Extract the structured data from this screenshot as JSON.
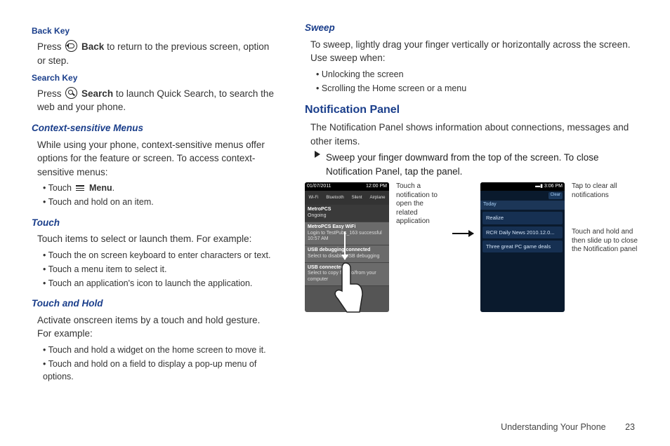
{
  "left": {
    "back_key": {
      "heading": "Back Key",
      "text_pre": "Press ",
      "icon_label": "Back",
      "text_post": " to return to the previous screen, option or step."
    },
    "search_key": {
      "heading": "Search Key",
      "text_pre": "Press ",
      "icon_label": "Search",
      "text_post": " to launch Quick Search, to search the web and your phone."
    },
    "context_menus": {
      "heading": "Context-sensitive Menus",
      "body": "While using your phone, context-sensitive menus offer options for the feature or screen. To access context-sensitive menus:",
      "bullet1_pre": "Touch ",
      "bullet1_label": "Menu",
      "bullet1_post": ".",
      "bullet2": "Touch and hold on an item."
    },
    "touch": {
      "heading": "Touch",
      "body": "Touch items to select or launch them. For example:",
      "bullets": [
        "Touch the on screen keyboard to enter characters or text.",
        "Touch a menu item to select it.",
        "Touch an application's icon to launch the application."
      ]
    },
    "touch_hold": {
      "heading": "Touch and Hold",
      "body": "Activate onscreen items by a touch and hold gesture. For example:",
      "bullets": [
        "Touch and hold a widget on the home screen to move it.",
        "Touch and hold on a field to display a pop-up menu of options."
      ]
    }
  },
  "right": {
    "sweep": {
      "heading": "Sweep",
      "body": "To sweep, lightly drag your finger vertically or horizontally across the screen. Use sweep when:",
      "bullets": [
        "Unlocking the screen",
        "Scrolling the Home screen or a menu"
      ]
    },
    "notif": {
      "heading": "Notification Panel",
      "body": "The Notification Panel shows information about connections, messages and other items.",
      "step": "Sweep your finger downward from the top of the screen. To close Notification Panel, tap the panel."
    },
    "figure": {
      "phone1": {
        "status_left": "01/07/2011",
        "status_right": "12:00 PM",
        "top_labels": [
          "Wi-Fi",
          "Bluetooth",
          "Silent",
          "Airplane"
        ],
        "section1": "MetroPCS",
        "section1b": "Ongoing",
        "row1_title": "MetroPCS Easy WiFi",
        "row1_sub": "Login to TestPubs_163 successful    10:57 AM",
        "row2_title": "USB debugging connected",
        "row2_sub": "Select to disable USB debugging",
        "row3_title": "USB connected",
        "row3_sub": "Select to copy files to/from your computer"
      },
      "annot_left": "Touch a notification to open the related application",
      "phone2": {
        "status_time": "3:06 PM",
        "clear": "Clear",
        "today": "Today",
        "card1": "Realize",
        "card2": "RCR Daily News 2010.12.0...",
        "card3": "Three great PC game deals"
      },
      "annot_right1": "Tap to clear all notifications",
      "annot_right2": "Touch and hold and then slide up to close the Notification panel"
    }
  },
  "footer": {
    "section": "Understanding Your Phone",
    "page": "23"
  }
}
